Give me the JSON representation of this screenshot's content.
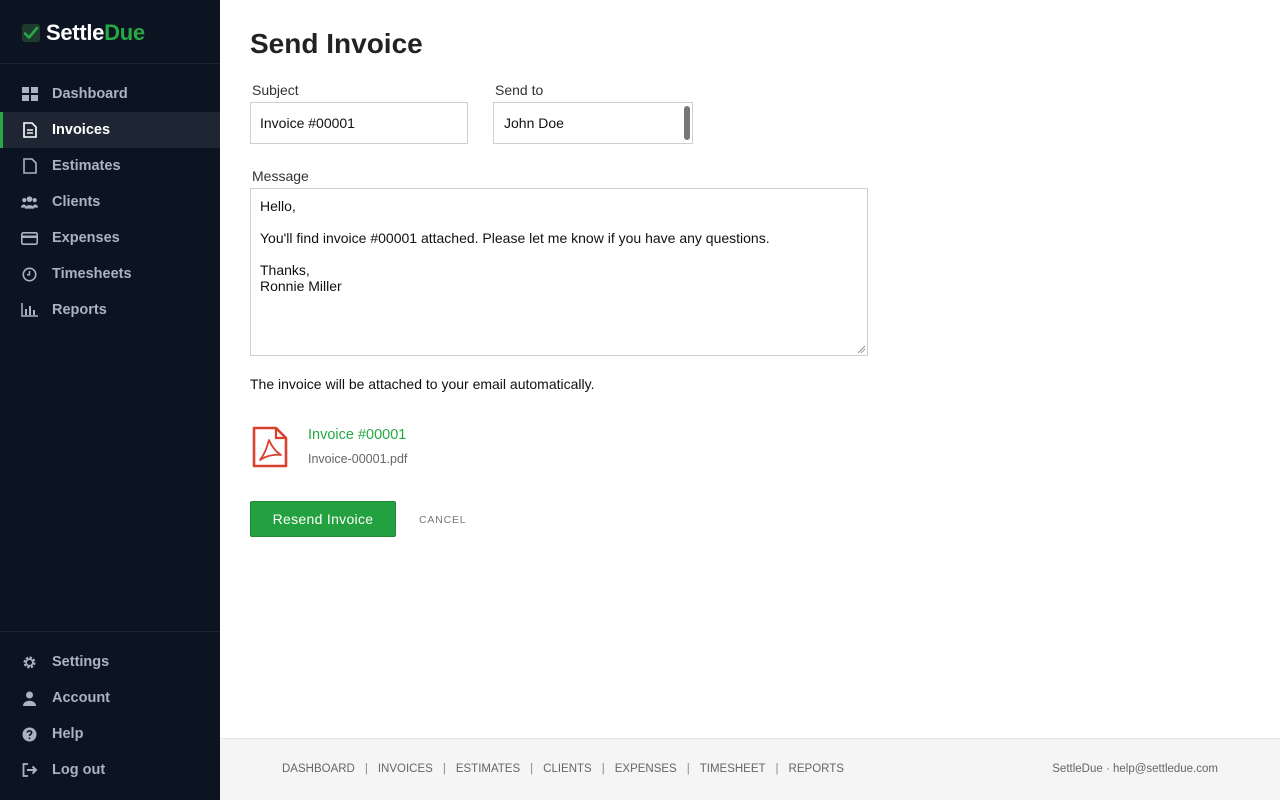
{
  "brand": {
    "name_main": "Settle",
    "name_accent": "Due"
  },
  "sidebar": {
    "items": [
      {
        "label": "Dashboard",
        "icon": "dashboard-icon"
      },
      {
        "label": "Invoices",
        "icon": "invoice-icon",
        "active": true
      },
      {
        "label": "Estimates",
        "icon": "document-icon"
      },
      {
        "label": "Clients",
        "icon": "users-icon"
      },
      {
        "label": "Expenses",
        "icon": "credit-card-icon"
      },
      {
        "label": "Timesheets",
        "icon": "clock-icon"
      },
      {
        "label": "Reports",
        "icon": "bar-chart-icon"
      }
    ],
    "bottom_items": [
      {
        "label": "Settings",
        "icon": "gear-icon"
      },
      {
        "label": "Account",
        "icon": "user-icon"
      },
      {
        "label": "Help",
        "icon": "question-icon"
      },
      {
        "label": "Log out",
        "icon": "logout-icon"
      }
    ]
  },
  "main": {
    "title": "Send Invoice",
    "subject_label": "Subject",
    "subject_value": "Invoice #00001",
    "sendto_label": "Send to",
    "sendto_value": "John Doe",
    "message_label": "Message",
    "message": {
      "line1": "Hello,",
      "line2": "You'll find invoice #00001 attached. Please let me know if you have any questions.",
      "line3": "Thanks,",
      "line4": "Ronnie Miller"
    },
    "attach_note": "The invoice will be attached to your email automatically.",
    "attachment": {
      "title": "Invoice #00001",
      "filename": "Invoice-00001.pdf",
      "icon": "pdf-icon"
    },
    "resend_label": "Resend Invoice",
    "cancel_label": "CANCEL"
  },
  "footer": {
    "links": [
      "DASHBOARD",
      "INVOICES",
      "ESTIMATES",
      "CLIENTS",
      "EXPENSES",
      "TIMESHEET",
      "REPORTS"
    ],
    "right_text": "SettleDue · help@settledue.com"
  },
  "colors": {
    "accent": "#27a844",
    "sidebar_bg": "#0d1421",
    "pdf_red": "#d9412f"
  }
}
